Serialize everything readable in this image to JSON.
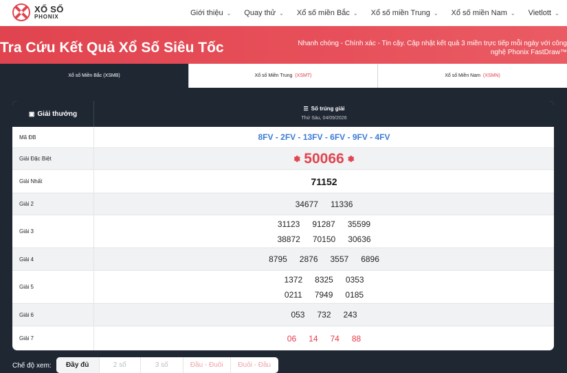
{
  "brand": {
    "line1": "XỔ SỐ",
    "line2": "PHONIX",
    "accent_color": "#e0444f"
  },
  "nav": {
    "items": [
      {
        "label": "Giới thiệu",
        "has_dropdown": true
      },
      {
        "label": "Quay thử",
        "has_dropdown": true
      },
      {
        "label": "Xổ số miền Bắc",
        "has_dropdown": true
      },
      {
        "label": "Xổ số miền Trung",
        "has_dropdown": true
      },
      {
        "label": "Xổ số miền Nam",
        "has_dropdown": true
      },
      {
        "label": "Vietlott",
        "has_dropdown": true
      }
    ]
  },
  "hero": {
    "title": "Tra Cứu Kết Quả Xổ Số Siêu Tốc",
    "subtitle": "Nhanh chóng - Chính xác - Tin cậy. Cập nhật kết quả 3 miền trực tiếp mỗi ngày với công nghệ Phonix FastDraw™"
  },
  "tabs": [
    {
      "label": "Xổ số Miền Bắc",
      "code": "(XSMB)",
      "active": true
    },
    {
      "label": "Xổ số Miền Trung",
      "code": "(XSMT)",
      "active": false
    },
    {
      "label": "Xổ số Miền Nam",
      "code": "(XSMN)",
      "active": false
    }
  ],
  "results": {
    "col_prize": "Giải thưởng",
    "col_numbers": "Số trúng giải",
    "date": "Thứ Sáu, 04/09/2026",
    "code_label": "Mã ĐB",
    "code_value": "8FV - 2FV - 13FV - 6FV - 9FV - 4FV",
    "special_label": "Giải Đặc Biệt",
    "special_value": "50066",
    "first_label": "Giải Nhất",
    "first_value": "71152",
    "g2_label": "Giải 2",
    "g2": [
      "34677",
      "11336"
    ],
    "g3_label": "Giải 3",
    "g3_row1": [
      "31123",
      "91287",
      "35599"
    ],
    "g3_row2": [
      "38872",
      "70150",
      "30636"
    ],
    "g4_label": "Giải 4",
    "g4": [
      "8795",
      "2876",
      "3557",
      "6896"
    ],
    "g5_label": "Giải 5",
    "g5_row1": [
      "1372",
      "8325",
      "0353"
    ],
    "g5_row2": [
      "0211",
      "7949",
      "0185"
    ],
    "g6_label": "Giải 6",
    "g6": [
      "053",
      "732",
      "243"
    ],
    "g7_label": "Giải 7",
    "g7": [
      "06",
      "14",
      "74",
      "88"
    ]
  },
  "view_modes": {
    "label": "Chế độ xem:",
    "options": [
      "Đầy đủ",
      "2 số",
      "3 số",
      "Đầu - Đuôi",
      "Đuôi - Đầu"
    ],
    "selected": "Đầy đủ"
  }
}
